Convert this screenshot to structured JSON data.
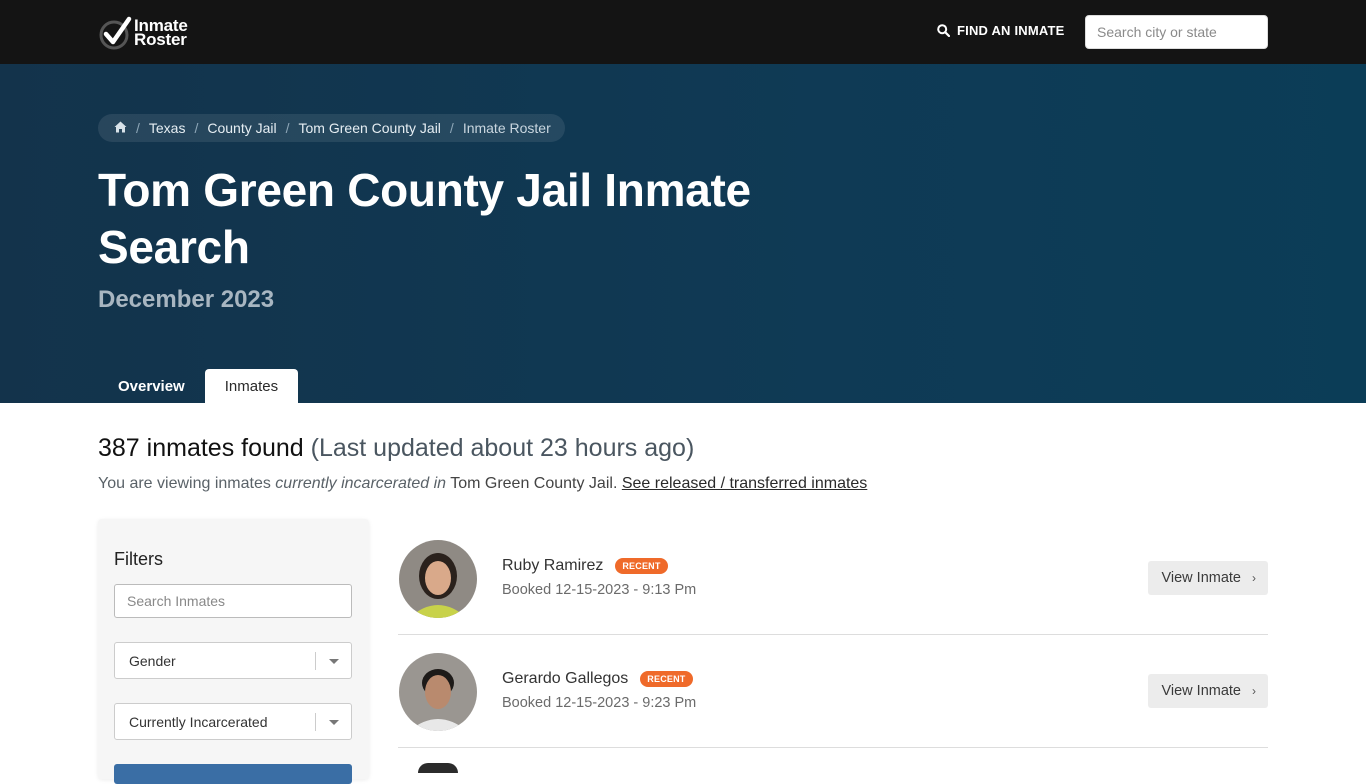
{
  "nav": {
    "logo_line1": "Inmate",
    "logo_line2": "Roster",
    "find_label": "FIND AN INMATE",
    "search_placeholder": "Search city or state"
  },
  "breadcrumb": [
    "Texas",
    "County Jail",
    "Tom Green County Jail",
    "Inmate Roster"
  ],
  "hero": {
    "title": "Tom Green County Jail Inmate Search",
    "subtitle": "December 2023"
  },
  "tabs": [
    {
      "label": "Overview",
      "active": false
    },
    {
      "label": "Inmates",
      "active": true
    }
  ],
  "results": {
    "count_text": "387 inmates found",
    "updated_text": "(Last updated about 23 hours ago)",
    "viewing_prefix": "You are viewing inmates",
    "viewing_em": "currently incarcerated in",
    "viewing_jail": "Tom Green County Jail.",
    "released_link": "See released / transferred inmates"
  },
  "filters": {
    "title": "Filters",
    "search_placeholder": "Search Inmates",
    "gender_value": "Gender",
    "status_value": "Currently Incarcerated"
  },
  "inmates": [
    {
      "name": "Ruby Ramirez",
      "badge": "RECENT",
      "booked": "Booked 12-15-2023 - 9:13 Pm",
      "button": "View Inmate"
    },
    {
      "name": "Gerardo Gallegos",
      "badge": "RECENT",
      "booked": "Booked 12-15-2023 - 9:23 Pm",
      "button": "View Inmate"
    }
  ],
  "colors": {
    "accent": "#ef6a2a",
    "nav_bg": "#141414",
    "hero_bg": "#0f3a55"
  }
}
